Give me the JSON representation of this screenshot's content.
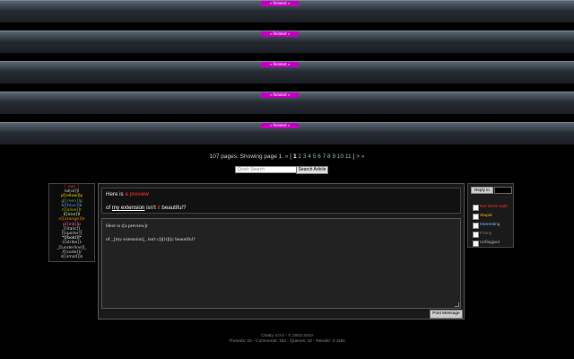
{
  "banner": {
    "label": "« Related »"
  },
  "pager": {
    "summary": "107 pages. Showing page 1.",
    "prev": "«",
    "open": "[",
    "current": "1",
    "pages": [
      "2",
      "3",
      "4",
      "5",
      "6",
      "7",
      "8",
      "9",
      "10",
      "11"
    ],
    "close": "]",
    "next_more": "> »"
  },
  "search": {
    "placeholder": "Quick Search",
    "button": "Search Article"
  },
  "tags": [
    {
      "label": "[ nws ]",
      "color": "#ff3030"
    },
    {
      "label": "lol[ol]]l",
      "color": "#ccc"
    },
    {
      "label": "y[[ellow]]y",
      "color": "#ffd700"
    },
    {
      "label": "g[[reen]]g",
      "color": "#4caf50"
    },
    {
      "label": "b[[blue]]b",
      "color": "#5b8cff"
    },
    {
      "label": "r[[olive]]r",
      "color": "#b5b500"
    },
    {
      "label": "l[[ime]]l",
      "color": "#aaffaa"
    },
    {
      "label": "n[[orange]]n",
      "color": "#ff8c00"
    },
    {
      "label": "p[[ink]]p",
      "color": "#ff69b4"
    },
    {
      "label": "_[[italic]]_",
      "color": "#ccc"
    },
    {
      "label": "[[spoiler]]",
      "color": "#ccc"
    },
    {
      "label": "*[[bold]]*",
      "color": "#fff"
    },
    {
      "label": "-[[strike]]-",
      "color": "#ccc"
    },
    {
      "label": "_[[underline]]_",
      "color": "#ccc"
    },
    {
      "label": "/[[code]]/",
      "color": "#ccc"
    },
    {
      "label": "s[[small]]s",
      "color": "#ccc"
    }
  ],
  "preview": {
    "l1_a": "Here is ",
    "l1_b": "a preview",
    "l2_a": "of ",
    "l2_link": "my extension",
    "l2_b": " isn't ",
    "l2_c": "it",
    "l2_d": " beautiful?"
  },
  "editor": {
    "line1": "Here is r[a preview]r",
    "line2": "of _[my extension]_ isn't c[i[it]i]c beautiful?"
  },
  "post_button": "Post Message",
  "side": {
    "reply_button": "Reply to",
    "options": [
      {
        "label": "Not Work Safe",
        "color": "#ff2a2a"
      },
      {
        "label": "Stupid",
        "color": "#ffb000"
      },
      {
        "label": "Interesting",
        "color": "#7fb2ff"
      },
      {
        "label": "Funny",
        "color": "#777"
      },
      {
        "label": "Unflagged",
        "color": "#aaa"
      }
    ]
  },
  "footer": {
    "line1": "Chatty 3.0.0 - © 2003-2010",
    "line2": "Threads: 15 - Comments: 152 - Queries: 32 - Render: 0.118s"
  }
}
